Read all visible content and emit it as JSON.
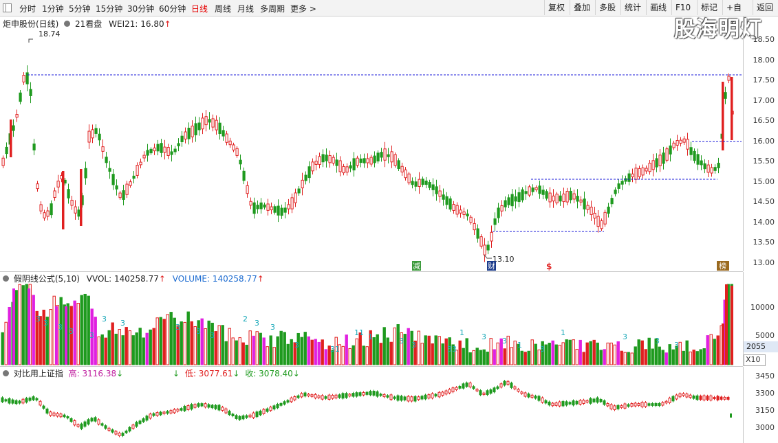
{
  "toolbar": {
    "periods": [
      "分时",
      "1分钟",
      "5分钟",
      "15分钟",
      "30分钟",
      "60分钟",
      "日线",
      "周线",
      "月线",
      "多周期",
      "更多 >"
    ],
    "active_period": "日线",
    "right_buttons": [
      "复权",
      "叠加",
      "多股",
      "统计",
      "画线",
      "F10",
      "标记",
      "+自选",
      "返回"
    ]
  },
  "logo_text": "股海明灯",
  "main_chart": {
    "title": "炬申股份(日线)",
    "indicator_label": "21看盘",
    "wei_label": "WEI21: 16.80",
    "wei_arrow": "↑",
    "high_marker": "18.74",
    "low_marker": "13.10",
    "y_ticks": [
      "18.50",
      "18.00",
      "17.50",
      "17.00",
      "16.50",
      "16.00",
      "15.50",
      "15.00",
      "14.50",
      "14.00",
      "13.50",
      "13.00"
    ],
    "event_badges": [
      "减",
      "财",
      "$",
      "榜"
    ]
  },
  "volume_chart": {
    "title": "假阴线公式(5,10)",
    "vvol_label": "VVOL: 140258.77",
    "volume_label": "VOLUME: 140258.77",
    "arrow": "↑",
    "y_ticks": [
      "10000",
      "5000"
    ],
    "current_value": "2055",
    "multiplier": "X10",
    "markers": [
      "3",
      "3",
      "3",
      "3",
      "3",
      "3",
      "3",
      "3",
      "3",
      "3",
      "2",
      "3",
      "3",
      "3",
      "31",
      "11",
      "1",
      "3",
      "3",
      "33",
      "1",
      "3",
      "3",
      "1",
      "3",
      "1",
      "3",
      "3",
      "3"
    ]
  },
  "index_chart": {
    "title": "对比用上证指",
    "high_label": "高: 3116.38",
    "low_label": "低: 3077.61",
    "close_label": "收: 3078.40",
    "arrow": "↓",
    "y_ticks": [
      "3450",
      "3300",
      "3150",
      "3000"
    ]
  },
  "colors": {
    "up": "#e02020",
    "down": "#1e9a1e",
    "magenta": "#e020e0",
    "marker": "#18a8b8",
    "guide": "#1a1ad8"
  }
}
